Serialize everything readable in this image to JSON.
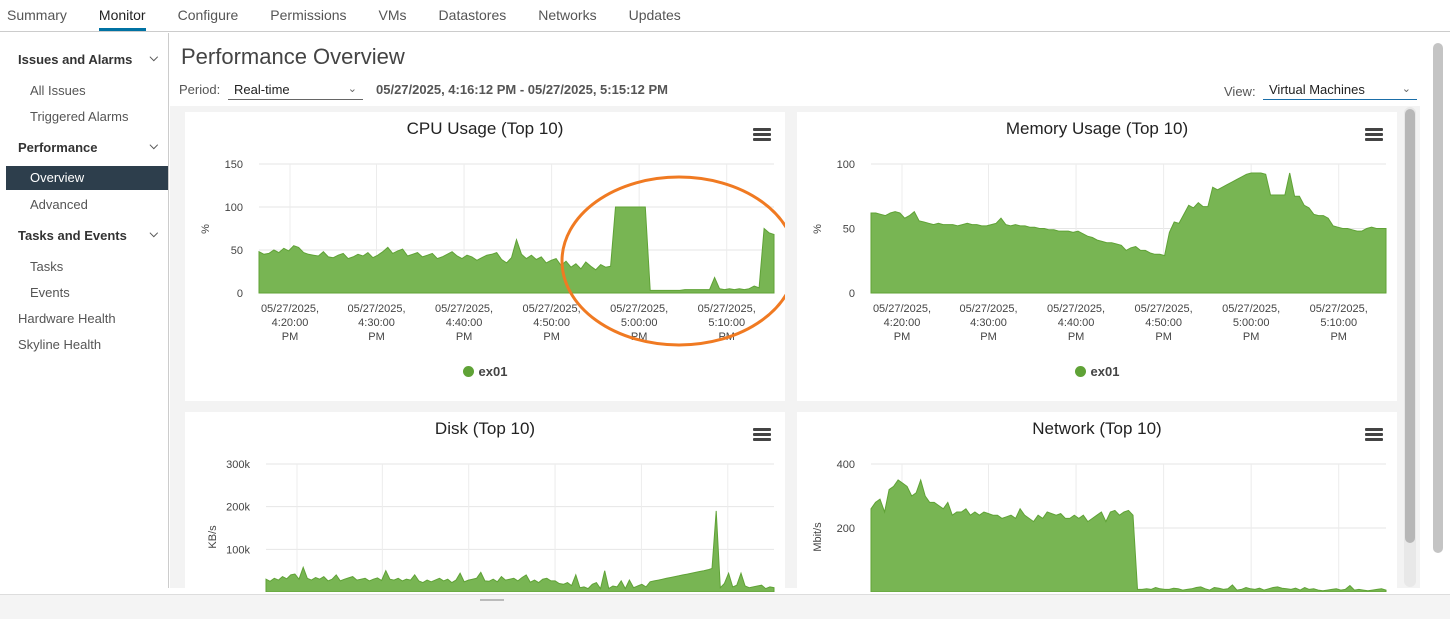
{
  "tabs": [
    "Summary",
    "Monitor",
    "Configure",
    "Permissions",
    "VMs",
    "Datastores",
    "Networks",
    "Updates"
  ],
  "sidebar": {
    "issues_group": "Issues and Alarms",
    "all_issues": "All Issues",
    "triggered_alarms": "Triggered Alarms",
    "performance_group": "Performance",
    "overview": "Overview",
    "advanced": "Advanced",
    "tasks_group": "Tasks and Events",
    "tasks": "Tasks",
    "events": "Events",
    "hardware_health": "Hardware Health",
    "skyline_health": "Skyline Health"
  },
  "main": {
    "title": "Performance Overview",
    "period_label": "Period:",
    "period_value": "Real-time",
    "date_range": "05/27/2025, 4:16:12 PM - 05/27/2025, 5:15:12 PM",
    "view_label": "View:",
    "view_value": "Virtual Machines"
  },
  "colors": {
    "series": "#5fa236",
    "fill": "#78b553",
    "annotation": "#f07a22",
    "accent": "#0072a3"
  },
  "chart_data": [
    {
      "type": "area",
      "title": "CPU Usage (Top 10)",
      "ylabel": "%",
      "ylim": [
        0,
        150
      ],
      "yticks": [
        "0",
        "50",
        "100",
        "150"
      ],
      "x_ticks": [
        [
          "05/27/2025,",
          "4:20:00",
          "PM"
        ],
        [
          "05/27/2025,",
          "4:30:00",
          "PM"
        ],
        [
          "05/27/2025,",
          "4:40:00",
          "PM"
        ],
        [
          "05/27/2025,",
          "4:50:00",
          "PM"
        ],
        [
          "05/27/2025,",
          "5:00:00",
          "PM"
        ],
        [
          "05/27/2025,",
          "5:10:00",
          "PM"
        ]
      ],
      "series": [
        {
          "name": "ex01",
          "values": [
            48,
            45,
            46,
            50,
            47,
            52,
            49,
            55,
            53,
            47,
            45,
            44,
            43,
            48,
            42,
            41,
            44,
            46,
            40,
            42,
            45,
            43,
            47,
            41,
            44,
            48,
            53,
            46,
            49,
            51,
            43,
            45,
            47,
            42,
            44,
            46,
            40,
            42,
            45,
            48,
            43,
            40,
            44,
            42,
            38,
            41,
            44,
            45,
            47,
            39,
            35,
            41,
            62,
            45,
            40,
            44,
            39,
            42,
            35,
            38,
            40,
            32,
            37,
            30,
            34,
            28,
            36,
            31,
            27,
            33,
            30,
            31,
            100,
            100,
            100,
            100,
            100,
            100,
            100,
            3,
            3,
            3,
            3,
            3,
            3,
            3,
            4,
            4,
            4,
            4,
            4,
            4,
            18,
            5,
            4,
            5,
            4,
            5,
            4,
            5,
            8,
            6,
            75,
            70,
            68
          ]
        }
      ]
    },
    {
      "type": "area",
      "title": "Memory Usage (Top 10)",
      "ylabel": "%",
      "ylim": [
        0,
        100
      ],
      "yticks": [
        "0",
        "50",
        "100"
      ],
      "x_ticks": [
        [
          "05/27/2025,",
          "4:20:00",
          "PM"
        ],
        [
          "05/27/2025,",
          "4:30:00",
          "PM"
        ],
        [
          "05/27/2025,",
          "4:40:00",
          "PM"
        ],
        [
          "05/27/2025,",
          "4:50:00",
          "PM"
        ],
        [
          "05/27/2025,",
          "5:00:00",
          "PM"
        ],
        [
          "05/27/2025,",
          "5:10:00",
          "PM"
        ]
      ],
      "series": [
        {
          "name": "ex01",
          "values": [
            62,
            62,
            61,
            60,
            62,
            63,
            62,
            58,
            60,
            63,
            56,
            55,
            54,
            53,
            54,
            53,
            53,
            53,
            52,
            53,
            54,
            53,
            53,
            52,
            52,
            53,
            54,
            58,
            53,
            52,
            53,
            52,
            52,
            51,
            51,
            50,
            50,
            49,
            49,
            48,
            48,
            48,
            47,
            48,
            46,
            44,
            43,
            41,
            40,
            39,
            39,
            38,
            37,
            33,
            35,
            36,
            33,
            33,
            31,
            30,
            30,
            29,
            47,
            55,
            54,
            61,
            68,
            66,
            70,
            67,
            67,
            82,
            80,
            82,
            84,
            86,
            88,
            90,
            92,
            93,
            93,
            93,
            92,
            76,
            76,
            76,
            76,
            93,
            75,
            75,
            68,
            66,
            61,
            60,
            60,
            58,
            52,
            51,
            50,
            50,
            49,
            48,
            48,
            50,
            51,
            50,
            50,
            50
          ]
        }
      ]
    },
    {
      "type": "area",
      "title": "Disk (Top 10)",
      "ylabel": "KB/s",
      "ylim": [
        0,
        300000
      ],
      "yticks": [
        "100k",
        "200k",
        "300k"
      ],
      "series": [
        {
          "name": "",
          "values": [
            30000,
            25000,
            32000,
            28000,
            36000,
            31000,
            40000,
            42000,
            30000,
            58000,
            32000,
            28000,
            34000,
            30000,
            36000,
            26000,
            30000,
            40000,
            26000,
            30000,
            33000,
            36000,
            28000,
            30000,
            32000,
            26000,
            30000,
            33000,
            27000,
            50000,
            30000,
            28000,
            32000,
            26000,
            30000,
            28000,
            40000,
            26000,
            22000,
            28000,
            24000,
            28000,
            32000,
            26000,
            30000,
            22000,
            28000,
            44000,
            24000,
            28000,
            30000,
            32000,
            46000,
            26000,
            25000,
            30000,
            24000,
            36000,
            28000,
            30000,
            32000,
            26000,
            34000,
            40000,
            23000,
            28000,
            22000,
            30000,
            32000,
            26000,
            26000,
            20000,
            18000,
            22000,
            15000,
            40000,
            10000,
            12000,
            8000,
            18000,
            22000,
            8000,
            50000,
            8000,
            14000,
            12000,
            26000,
            8000,
            28000,
            10000,
            14000,
            18000,
            12000,
            24000,
            26000,
            28000,
            30000,
            32000,
            34000,
            36000,
            38000,
            40000,
            42000,
            44000,
            46000,
            48000,
            50000,
            52000,
            55000,
            190000,
            10000,
            20000,
            44000,
            12000,
            16000,
            44000,
            14000,
            10000,
            12000,
            14000,
            16000,
            8000,
            12000,
            10000
          ]
        }
      ]
    },
    {
      "type": "area",
      "title": "Network (Top 10)",
      "ylabel": "Mbit/s",
      "ylim": [
        0,
        400
      ],
      "yticks": [
        "200",
        "400"
      ],
      "series": [
        {
          "name": "",
          "values": [
            260,
            280,
            290,
            250,
            320,
            330,
            350,
            340,
            330,
            300,
            310,
            350,
            300,
            280,
            280,
            270,
            260,
            280,
            240,
            250,
            250,
            260,
            240,
            250,
            240,
            250,
            245,
            240,
            240,
            230,
            235,
            240,
            230,
            260,
            240,
            230,
            220,
            240,
            230,
            250,
            245,
            240,
            245,
            230,
            230,
            240,
            230,
            240,
            220,
            230,
            240,
            250,
            220,
            250,
            255,
            240,
            250,
            255,
            240,
            8,
            8,
            10,
            8,
            14,
            10,
            8,
            8,
            12,
            10,
            6,
            8,
            10,
            14,
            16,
            10,
            6,
            14,
            12,
            8,
            10,
            22,
            6,
            8,
            14,
            10,
            8,
            12,
            6,
            10,
            14,
            16,
            12,
            10,
            8,
            12,
            6,
            14,
            8,
            10,
            6,
            4,
            6,
            8,
            10,
            6,
            8,
            20,
            6,
            8,
            6,
            4,
            6,
            8,
            10,
            6
          ]
        }
      ]
    }
  ]
}
